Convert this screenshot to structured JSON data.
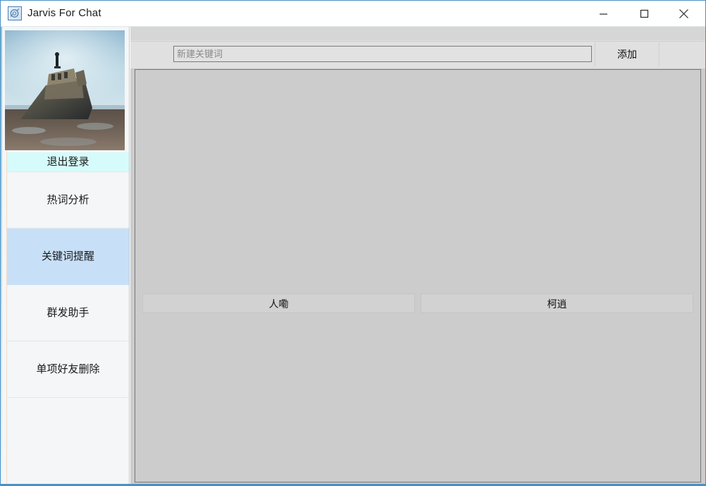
{
  "window": {
    "title": "Jarvis For Chat",
    "icon": "app-icon",
    "accent_color": "#4a90c4",
    "controls": {
      "minimize": "minimize-icon",
      "maximize": "maximize-icon",
      "close": "close-icon"
    }
  },
  "sidebar": {
    "avatar_alt": "shipwreck-avatar",
    "items": [
      {
        "label": "退出登录",
        "state": "logout"
      },
      {
        "label": "热词分析",
        "state": "normal"
      },
      {
        "label": "关键词提醒",
        "state": "selected"
      },
      {
        "label": "群发助手",
        "state": "normal"
      },
      {
        "label": "单项好友删除",
        "state": "normal"
      }
    ],
    "highlight_color": "#c7e0f8",
    "logout_color": "#d6fbfb"
  },
  "toolbar": {
    "keyword_input_value": "",
    "keyword_input_placeholder": "新建关键词",
    "add_label": "添加"
  },
  "main": {
    "keywords": [
      {
        "label": "人嘞"
      },
      {
        "label": "柯逍"
      }
    ]
  }
}
